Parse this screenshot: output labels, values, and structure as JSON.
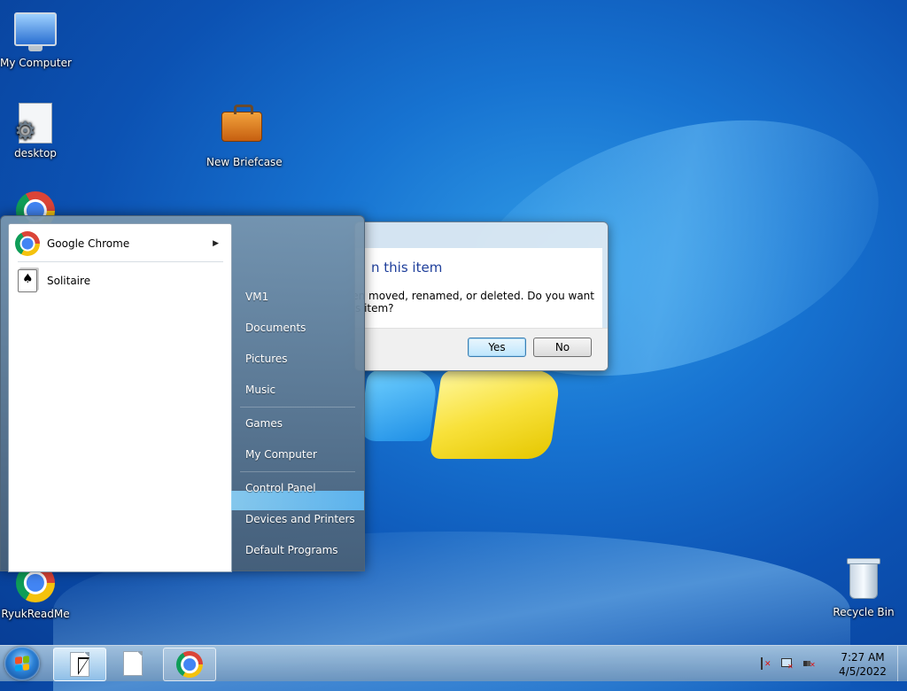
{
  "desktop": {
    "icons": {
      "my_computer": "My Computer",
      "desktop": "desktop",
      "new_briefcase": "New Briefcase",
      "ryuk_readme": "RyukReadMe",
      "recycle_bin": "Recycle Bin"
    }
  },
  "dialog": {
    "title": "n this item",
    "message_line1": "been moved, renamed, or deleted. Do you want",
    "message_line2": "s item?",
    "yes_label": "Yes",
    "no_label": "No"
  },
  "start_menu": {
    "programs": [
      {
        "label": "Google Chrome",
        "icon": "chrome-icon",
        "has_submenu": true
      },
      {
        "label": "Solitaire",
        "icon": "solitaire-icon"
      }
    ],
    "places": [
      {
        "label": "VM1"
      },
      {
        "label": "Documents"
      },
      {
        "label": "Pictures"
      },
      {
        "label": "Music"
      },
      {
        "label": "Games"
      },
      {
        "label": "My Computer"
      },
      {
        "label": "Control Panel"
      },
      {
        "label": "Devices and Printers"
      },
      {
        "label": "Default Programs"
      }
    ]
  },
  "taskbar": {
    "clock_time": "7:27 AM",
    "clock_date": "4/5/2022"
  },
  "colors": {
    "dialog_title": "#1f3f9b",
    "start_menu_glass": "#5f7f9e"
  }
}
